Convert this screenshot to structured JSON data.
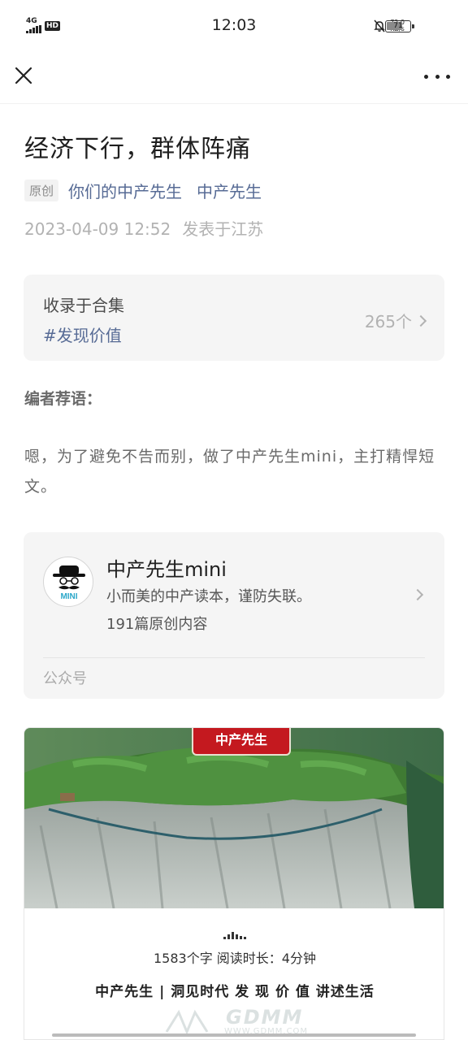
{
  "status_bar": {
    "network": "4G",
    "hd": "HD",
    "time": "12:03",
    "speed_value": "72.0",
    "speed_unit": "KB/s",
    "battery": "71",
    "battery_level": 0.71
  },
  "nav": {
    "close_icon": "close-icon",
    "more_icon": "more-icon"
  },
  "article": {
    "title": "经济下行，群体阵痛",
    "original_tag": "原创",
    "author_1": "你们的中产先生",
    "author_2": "中产先生",
    "date": "2023-04-09 12:52",
    "location": "发表于江苏"
  },
  "collection": {
    "label": "收录于合集",
    "tag": "#发现价值",
    "count": "265个"
  },
  "editor": {
    "title": "编者荐语：",
    "body": "嗯，为了避免不告而别，做了中产先生mini，主打精悍短文。"
  },
  "account_card": {
    "name": "中产先生mini",
    "description": "小而美的中产读本，谨防失联。",
    "count": "191篇原创内容",
    "type": "公众号",
    "avatar_text": "MINI"
  },
  "image_card": {
    "banner": "中产先生",
    "stats": "1583个字 阅读时长：4分钟",
    "slogan": "中产先生 | 洞见时代 发 现 价 值  讲述生活"
  },
  "watermark": {
    "url": "WWW.GDMM.COM"
  },
  "colors": {
    "link": "#576b95",
    "muted": "#b2b2b2",
    "card_bg": "#f5f5f5",
    "banner_red": "#c4191f"
  }
}
